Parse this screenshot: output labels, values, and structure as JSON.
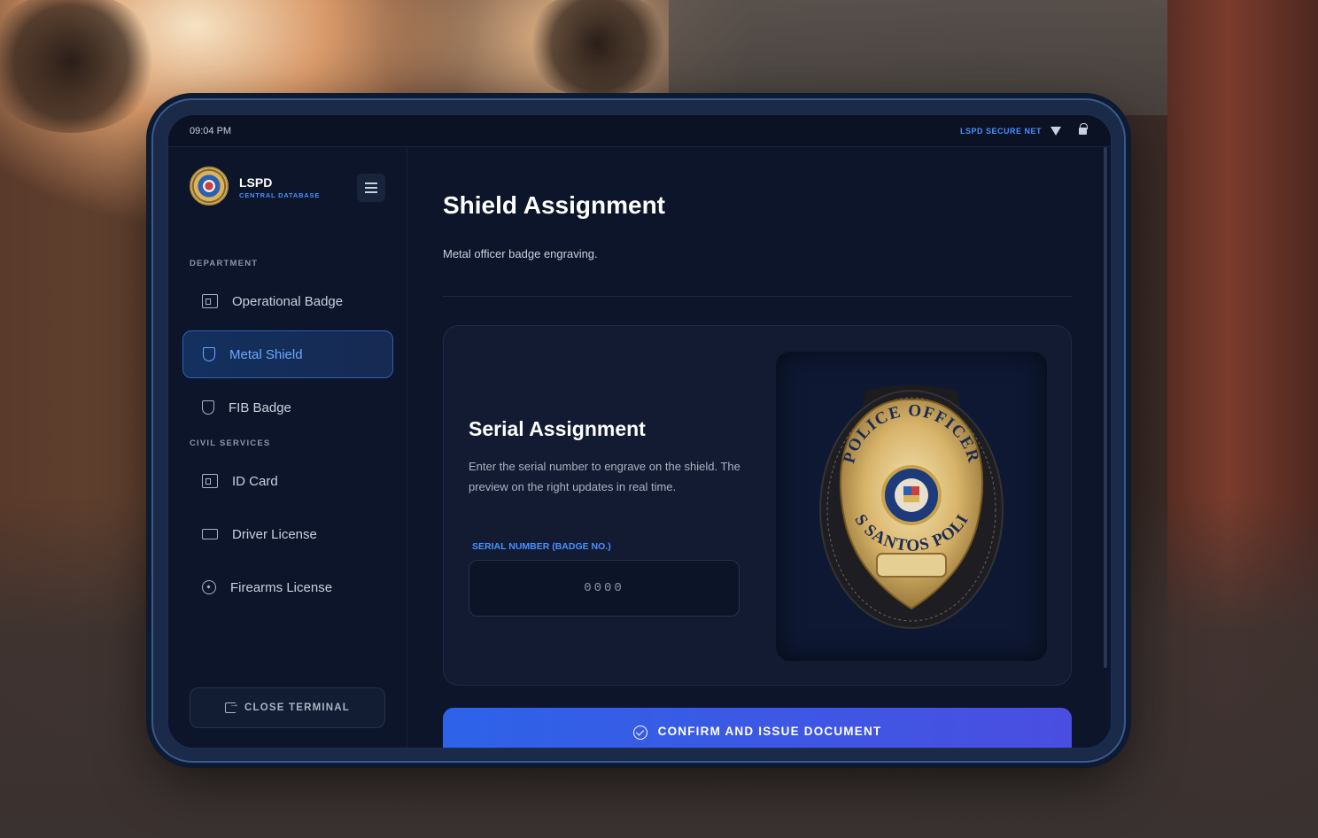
{
  "status_bar": {
    "time": "09:04 PM",
    "network": "LSPD SECURE NET",
    "wifi_icon": "wifi-icon",
    "lock_icon": "lock-icon"
  },
  "sidebar": {
    "brand": "LSPD",
    "brand_sub": "CENTRAL DATABASE",
    "sections": [
      {
        "label": "DEPARTMENT",
        "items": [
          {
            "label": "Operational Badge",
            "icon": "id-badge-icon",
            "active": false
          },
          {
            "label": "Metal Shield",
            "icon": "shield-icon",
            "active": true
          },
          {
            "label": "FIB Badge",
            "icon": "shield-check-icon",
            "active": false
          }
        ]
      },
      {
        "label": "CIVIL SERVICES",
        "items": [
          {
            "label": "ID Card",
            "icon": "id-card-icon",
            "active": false
          },
          {
            "label": "Driver License",
            "icon": "car-icon",
            "active": false
          },
          {
            "label": "Firearms License",
            "icon": "target-icon",
            "active": false
          }
        ]
      }
    ],
    "close_label": "CLOSE TERMINAL"
  },
  "main": {
    "title": "Shield Assignment",
    "subtitle": "Metal officer badge engraving.",
    "card": {
      "title": "Serial Assignment",
      "description": "Enter the serial number to engrave on the shield. The preview on the right updates in real time.",
      "field_label": "SERIAL NUMBER (BADGE NO.)",
      "field_placeholder": "0000",
      "field_value": ""
    },
    "badge_preview": {
      "top_text": "POLICE OFFICER",
      "bottom_text": "LOS SANTOS POLICE"
    },
    "confirm_label": "CONFIRM AND ISSUE DOCUMENT"
  },
  "colors": {
    "accent": "#4a90ff",
    "active_bg": "#13305f",
    "panel_bg": "#0c1529",
    "button_start": "#2d63e8",
    "button_end": "#4a4ee0"
  }
}
